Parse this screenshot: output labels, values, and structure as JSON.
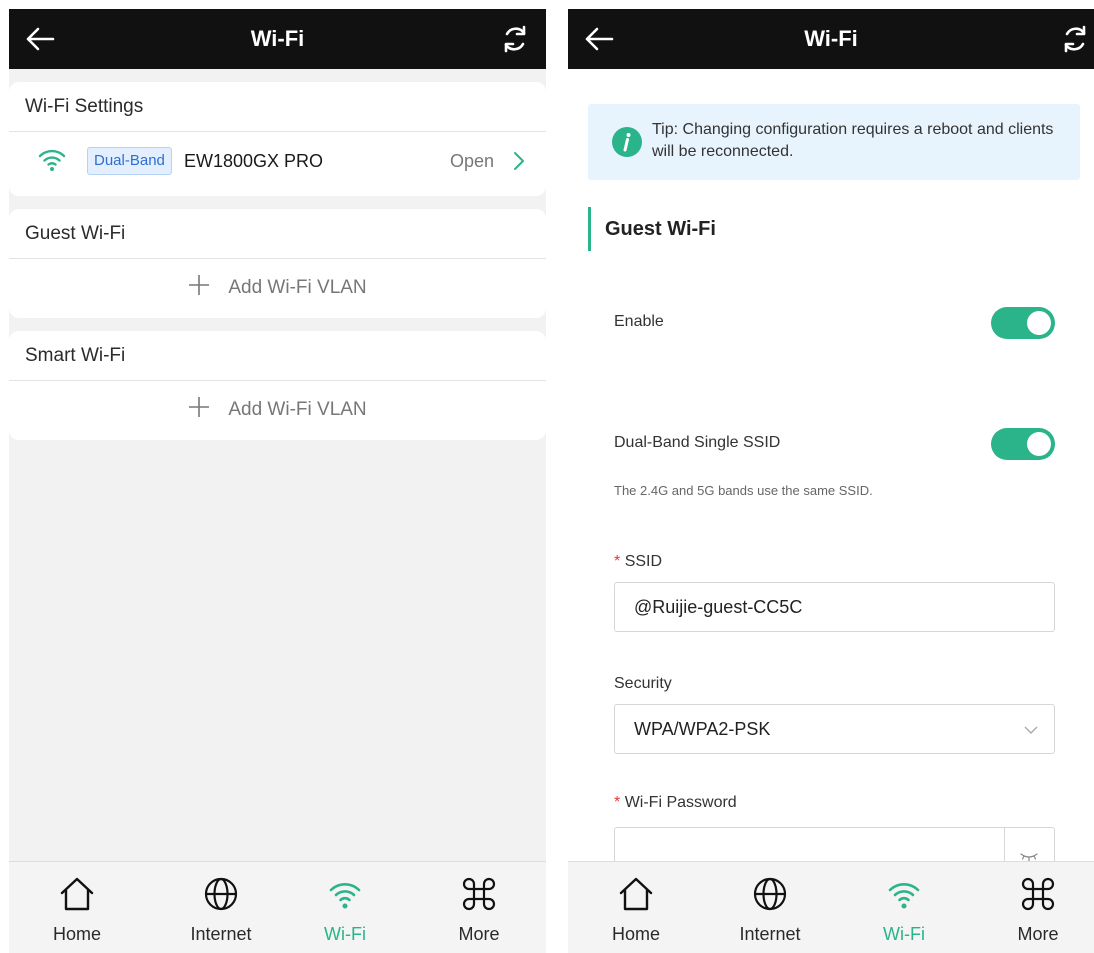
{
  "colors": {
    "accent": "#2bb38a",
    "topbar": "#111111",
    "badge": "#2d6fd1"
  },
  "left": {
    "title": "Wi-Fi",
    "wifi_settings": {
      "header": "Wi-Fi Settings",
      "band": "Dual-Band",
      "ssid": "EW1800GX PRO",
      "status": "Open"
    },
    "guest_wifi": {
      "header": "Guest Wi-Fi",
      "add_label": "Add Wi-Fi VLAN"
    },
    "smart_wifi": {
      "header": "Smart Wi-Fi",
      "add_label": "Add Wi-Fi VLAN"
    }
  },
  "right": {
    "title": "Wi-Fi",
    "tip": "Tip: Changing configuration requires a reboot and clients will be reconnected.",
    "section_title": "Guest Wi-Fi",
    "enable": {
      "label": "Enable",
      "on": true
    },
    "dual_band": {
      "label": "Dual-Band Single SSID",
      "on": true,
      "hint": "The 2.4G and 5G bands use the same SSID."
    },
    "ssid": {
      "label": "SSID",
      "required_mark": "*",
      "value": "@Ruijie-guest-CC5C"
    },
    "security": {
      "label": "Security",
      "value": "WPA/WPA2-PSK"
    },
    "password": {
      "label": "Wi-Fi Password",
      "required_mark": "*",
      "value": ""
    }
  },
  "tabs": [
    {
      "label": "Home",
      "icon": "home-icon",
      "active": false
    },
    {
      "label": "Internet",
      "icon": "globe-icon",
      "active": false
    },
    {
      "label": "Wi-Fi",
      "icon": "wifi-icon",
      "active": true
    },
    {
      "label": "More",
      "icon": "command-icon",
      "active": false
    }
  ]
}
